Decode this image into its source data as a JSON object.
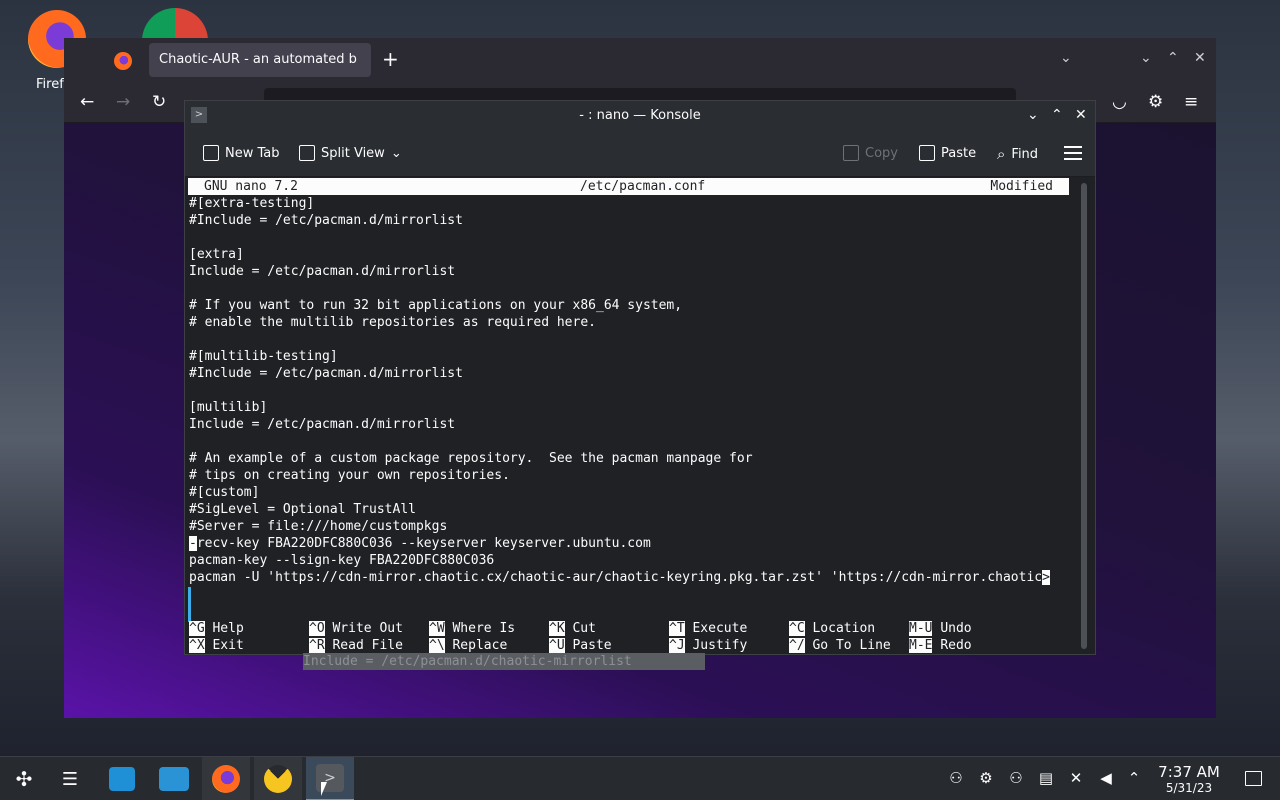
{
  "desktop": {
    "firefox_label": "Firef"
  },
  "firefox": {
    "tab_title": "Chaotic-AUR - an automated b",
    "new_tab_symbol": "+",
    "url_placeholder": ""
  },
  "konsole": {
    "title": "- : nano — Konsole",
    "toolbar": {
      "new_tab": "New Tab",
      "split_view": "Split View",
      "copy": "Copy",
      "paste": "Paste",
      "find": "Find"
    }
  },
  "nano": {
    "header_left": "GNU nano 7.2",
    "header_mid": "/etc/pacman.conf",
    "header_right": "Modified",
    "lines": [
      "#[extra-testing]",
      "#Include = /etc/pacman.d/mirrorlist",
      "",
      "[extra]",
      "Include = /etc/pacman.d/mirrorlist",
      "",
      "# If you want to run 32 bit applications on your x86_64 system,",
      "# enable the multilib repositories as required here.",
      "",
      "#[multilib-testing]",
      "#Include = /etc/pacman.d/mirrorlist",
      "",
      "[multilib]",
      "Include = /etc/pacman.d/mirrorlist",
      "",
      "# An example of a custom package repository.  See the pacman manpage for",
      "# tips on creating your own repositories.",
      "#[custom]",
      "#SigLevel = Optional TrustAll",
      "#Server = file:///home/custompkgs",
      "recv-key FBA220DFC880C036 --keyserver keyserver.ubuntu.com",
      "pacman-key --lsign-key FBA220DFC880C036",
      "pacman -U 'https://cdn-mirror.chaotic.cx/chaotic-aur/chaotic-keyring.pkg.tar.zst' 'https://cdn-mirror.chaotic"
    ],
    "cursor_char": "-",
    "overflow_char": ">",
    "shortcuts": [
      {
        "key": "^G",
        "label": "Help"
      },
      {
        "key": "^O",
        "label": "Write Out"
      },
      {
        "key": "^W",
        "label": "Where Is"
      },
      {
        "key": "^K",
        "label": "Cut"
      },
      {
        "key": "^T",
        "label": "Execute"
      },
      {
        "key": "^C",
        "label": "Location"
      },
      {
        "key": "M-U",
        "label": "Undo"
      },
      {
        "key": "^X",
        "label": "Exit"
      },
      {
        "key": "^R",
        "label": "Read File"
      },
      {
        "key": "^\\",
        "label": "Replace"
      },
      {
        "key": "^U",
        "label": "Paste"
      },
      {
        "key": "^J",
        "label": "Justify"
      },
      {
        "key": "^/",
        "label": "Go To Line"
      },
      {
        "key": "M-E",
        "label": "Redo"
      }
    ]
  },
  "leaked_text": "Include = /etc/pacman.d/chaotic-mirrorlist",
  "taskbar": {
    "time": "7:37 AM",
    "date": "5/31/23"
  },
  "colors": {
    "accent": "#3daee9",
    "terminal_bg": "#1f2125",
    "terminal_fg": "#fcfcfc"
  }
}
